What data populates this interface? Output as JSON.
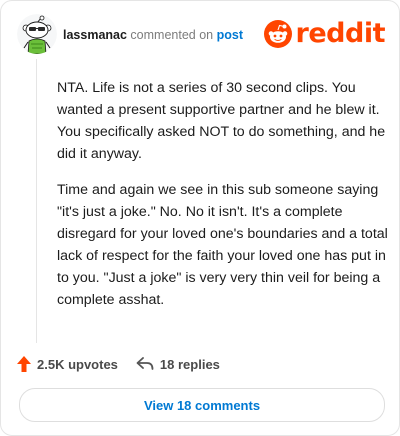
{
  "comment": {
    "username": "lassmanac",
    "action_text": "commented on",
    "post_link": "post",
    "paragraphs": [
      "NTA. Life is not a series of 30 second clips. You wanted a present supportive partner and he blew it. You specifically asked NOT to do something, and he did it anyway.",
      "Time and again we see in this sub someone saying \"it's just a joke.\" No. No it isn't. It's a complete disregard for your loved one's boundaries and a total lack of respect for the faith your loved one has put in to you. \"Just a joke\" is very very thin veil for being a complete asshat."
    ]
  },
  "brand": {
    "logo_text": "reddit",
    "color": "#ff4500",
    "icon": "reddit-snoo-icon"
  },
  "actions": {
    "upvotes_label": "2.5K upvotes",
    "replies_label": "18 replies",
    "upvote_icon": "upvote-arrow-icon",
    "reply_icon": "reply-arrow-icon"
  },
  "view_comments_label": "View 18 comments",
  "colors": {
    "link": "#0079d3",
    "upvote": "#ff4500",
    "muted": "#7c7c7c"
  }
}
